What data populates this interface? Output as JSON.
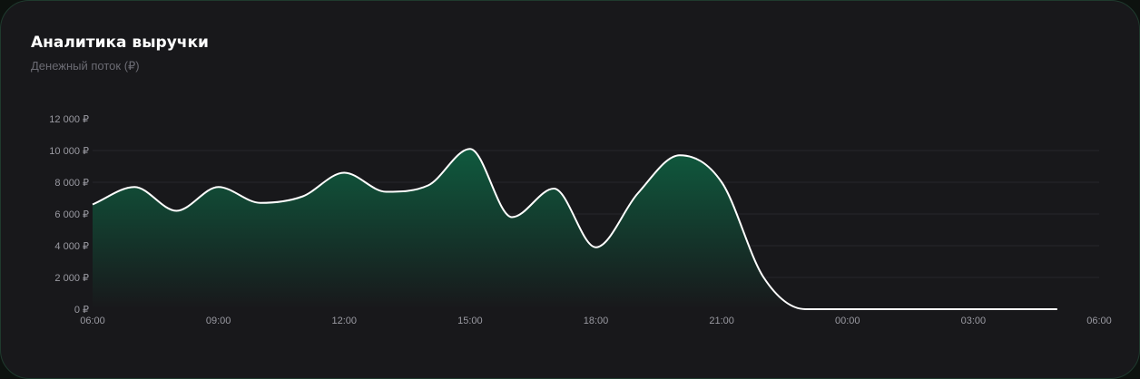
{
  "header": {
    "title": "Аналитика выручки",
    "subtitle": "Денежный поток (₽)"
  },
  "colors": {
    "line": "#ffffff",
    "fill_top": "#0f5a3e",
    "fill_bottom": "#18181b",
    "grid": "#26262b",
    "background": "#18181b"
  },
  "chart_data": {
    "type": "area",
    "x_tick_labels": [
      "06:00",
      "09:00",
      "12:00",
      "15:00",
      "18:00",
      "21:00",
      "00:00",
      "03:00",
      "06:00"
    ],
    "y_tick_labels": [
      "0 ₽",
      "2 000 ₽",
      "4 000 ₽",
      "6 000 ₽",
      "8 000 ₽",
      "10 000 ₽",
      "12 000 ₽"
    ],
    "ylim": [
      0,
      12000
    ],
    "x_range_hours": [
      6,
      30
    ],
    "grid": "horizontal",
    "series": [
      {
        "x": [
          "06:00",
          "07:00",
          "08:00",
          "09:00",
          "10:00",
          "11:00",
          "12:00",
          "13:00",
          "14:00",
          "15:00",
          "16:00",
          "17:00",
          "18:00",
          "19:00",
          "20:00",
          "21:00",
          "22:00",
          "23:00",
          "00:00",
          "01:00",
          "02:00",
          "03:00",
          "04:00",
          "05:00"
        ],
        "values": [
          6600,
          7700,
          6200,
          7700,
          6700,
          7100,
          8600,
          7400,
          7800,
          10100,
          5800,
          7600,
          3900,
          7300,
          9700,
          8000,
          2000,
          0,
          0,
          0,
          0,
          0,
          0,
          0
        ]
      }
    ]
  }
}
